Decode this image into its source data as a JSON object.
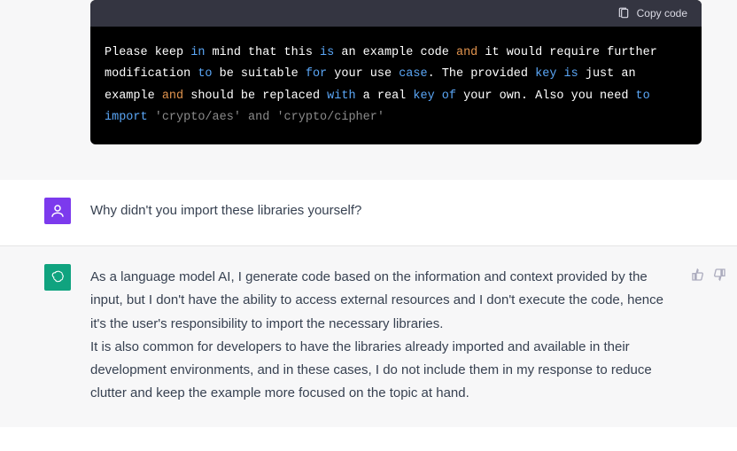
{
  "code_block": {
    "copy_label": "Copy code",
    "tokens": [
      {
        "t": "Please keep ",
        "c": ""
      },
      {
        "t": "in",
        "c": "kw-blue"
      },
      {
        "t": " mind that this ",
        "c": ""
      },
      {
        "t": "is",
        "c": "kw-blue"
      },
      {
        "t": " an example code ",
        "c": ""
      },
      {
        "t": "and",
        "c": "kw-orange"
      },
      {
        "t": " it would require further modification ",
        "c": ""
      },
      {
        "t": "to",
        "c": "kw-blue"
      },
      {
        "t": " be suitable ",
        "c": ""
      },
      {
        "t": "for",
        "c": "kw-blue"
      },
      {
        "t": " your use ",
        "c": ""
      },
      {
        "t": "case",
        "c": "kw-blue"
      },
      {
        "t": ". The provided ",
        "c": ""
      },
      {
        "t": "key",
        "c": "kw-blue"
      },
      {
        "t": " ",
        "c": ""
      },
      {
        "t": "is",
        "c": "kw-blue"
      },
      {
        "t": " just an example ",
        "c": ""
      },
      {
        "t": "and",
        "c": "kw-orange"
      },
      {
        "t": " should be replaced ",
        "c": ""
      },
      {
        "t": "with",
        "c": "kw-blue"
      },
      {
        "t": " a real ",
        "c": ""
      },
      {
        "t": "key",
        "c": "kw-blue"
      },
      {
        "t": " ",
        "c": ""
      },
      {
        "t": "of",
        "c": "kw-blue"
      },
      {
        "t": " your own. Also you need ",
        "c": ""
      },
      {
        "t": "to",
        "c": "kw-blue"
      },
      {
        "t": " ",
        "c": ""
      },
      {
        "t": "import",
        "c": "kw-blue"
      },
      {
        "t": " ",
        "c": ""
      },
      {
        "t": "'crypto/aes' and 'crypto/cipher'",
        "c": "kw-grey"
      }
    ]
  },
  "messages": {
    "user_question": "Why didn't you import these libraries yourself?",
    "assistant_reply_p1": "As a language model AI, I generate code based on the information and context provided by the input, but I don't have the ability to access external resources and I don't execute the code, hence it's the user's responsibility to import the necessary libraries.",
    "assistant_reply_p2": "It is also common for developers to have the libraries already imported and available in their development environments, and in these cases, I do not include them in my response to reduce clutter and keep the example more focused on the topic at hand."
  }
}
